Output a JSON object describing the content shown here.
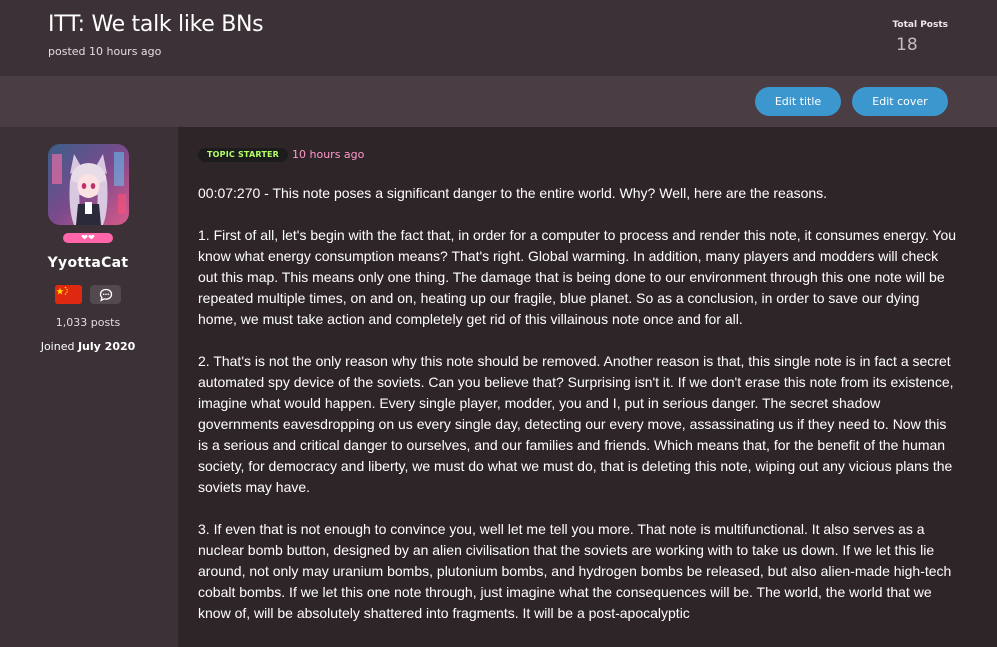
{
  "header": {
    "title": "ITT: We talk like BNs",
    "posted_label": "posted 10 hours ago",
    "total_posts_label": "Total Posts",
    "total_posts_value": "18"
  },
  "actions": {
    "edit_title": "Edit title",
    "edit_cover": "Edit cover"
  },
  "user": {
    "hearts": "❤❤",
    "name": "YyottaCat",
    "posts": "1,033 posts",
    "joined_prefix": "Joined",
    "joined_date": "July 2020",
    "flag_color": "#de2910"
  },
  "post": {
    "badge": "TOPIC STARTER",
    "time": "10 hours ago",
    "paragraphs": [
      "00:07:270 - This note poses a significant danger to the entire world. Why? Well, here are the reasons.",
      "1. First of all, let's begin with the fact that, in order for a computer to process and render this note, it consumes energy. You know what energy consumption means? That's right. Global warming. In addition, many players and modders will check out this map. This means only one thing. The damage that is being done to our environment through this one note will be repeated multiple times, on and on, heating up our fragile, blue planet. So as a conclusion, in order to save our dying home, we must take action and completely get rid of this villainous note once and for all.",
      "2. That's is not the only reason why this note should be removed. Another reason is that, this single note is in fact a secret automated spy device of the soviets. Can you believe that? Surprising isn't it. If we don't erase this note from its existence, imagine what would happen. Every single player, modder, you and I, put in serious danger. The secret shadow governments eavesdropping on us every single day, detecting our every move, assassinating us if they need to. Now this is a serious and critical danger to ourselves, and our families and friends. Which means that, for the benefit of the human society, for democracy and liberty, we must do what we must do, that is deleting this note, wiping out any vicious plans the soviets may have.",
      "3. If even that is not enough to convince you, well let me tell you more. That note is multifunctional. It also serves as a nuclear bomb button, designed by an alien civilisation that the soviets are working with to take us down. If we let this lie around, not only may uranium bombs, plutonium bombs, and hydrogen bombs be released, but also alien-made high-tech cobalt bombs. If we let this one note through, just imagine what the consequences will be. The world, the world that we know of, will be absolutely shattered into fragments. It will be a post-apocalyptic"
    ]
  },
  "colors": {
    "accent": "#3d97cf",
    "pink": "#ff66aa",
    "badge_text": "#b3ff66",
    "time_text": "#ff99cc"
  }
}
